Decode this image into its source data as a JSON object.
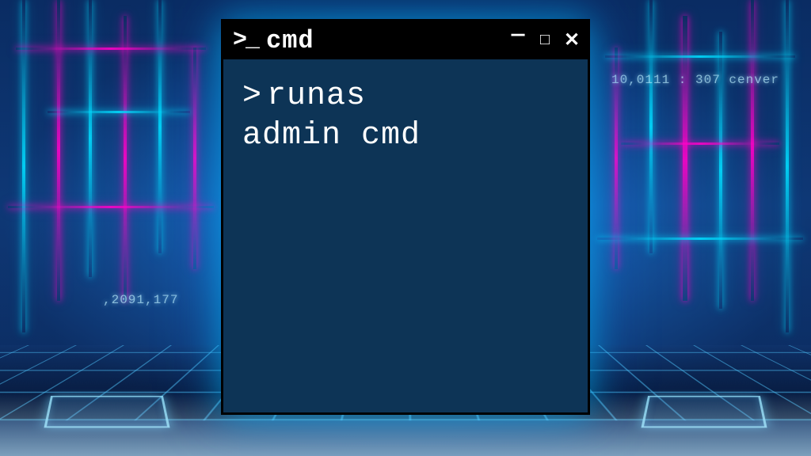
{
  "window": {
    "title": "cmd",
    "icon_label": ">_"
  },
  "terminal": {
    "prompt": ">",
    "command_line1": "runas",
    "command_line2": "admin cmd"
  },
  "background": {
    "decor_left": ",2091,177",
    "decor_right": "10,0111 : 307  cenver"
  },
  "colors": {
    "terminal_bg": "#0d3456",
    "titlebar_bg": "#000000",
    "text": "#ffffff",
    "neon_pink": "#ff00c8",
    "neon_cyan": "#00dcff"
  }
}
